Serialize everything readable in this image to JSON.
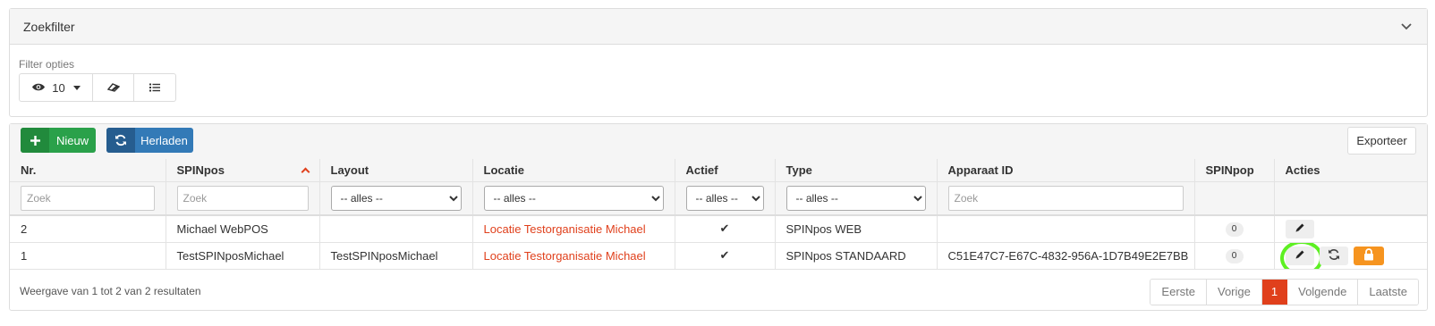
{
  "filter": {
    "title": "Zoekfilter",
    "options_label": "Filter opties",
    "page_size": "10"
  },
  "toolbar": {
    "new_label": "Nieuw",
    "reload_label": "Herladen",
    "export_label": "Exporteer"
  },
  "table": {
    "columns": [
      "Nr.",
      "SPINpos",
      "Layout",
      "Locatie",
      "Actief",
      "Type",
      "Apparaat ID",
      "SPINpop",
      "Acties"
    ],
    "filters": {
      "nr_placeholder": "Zoek",
      "spinpos_placeholder": "Zoek",
      "apparaat_placeholder": "Zoek",
      "all_option": "-- alles --"
    },
    "rows": [
      {
        "nr": "2",
        "spinpos": "Michael WebPOS",
        "layout": "",
        "locatie": "Locatie Testorganisatie Michael",
        "actief": "✔",
        "type": "SPINpos WEB",
        "apparaat_id": "",
        "spinpop": "0"
      },
      {
        "nr": "1",
        "spinpos": "TestSPINposMichael",
        "layout": "TestSPINposMichael",
        "locatie": "Locatie Testorganisatie Michael",
        "actief": "✔",
        "type": "SPINpos STANDAARD",
        "apparaat_id": "C51E47C7-E67C-4832-956A-1D7B49E2E7BB",
        "spinpop": "0"
      }
    ]
  },
  "footer": {
    "summary": "Weergave van 1 tot 2 van 2 resultaten",
    "pager": {
      "first": "Eerste",
      "prev": "Vorige",
      "current": "1",
      "next": "Volgende",
      "last": "Laatste"
    }
  },
  "colors": {
    "accent": "#e0401c",
    "success": "#2aa14a",
    "primary": "#337ab7",
    "warning": "#f6941f",
    "highlight": "#5df022"
  },
  "icons": [
    "chevron-down-icon",
    "eye-icon",
    "caret-down-icon",
    "eraser-icon",
    "list-icon",
    "plus-icon",
    "refresh-icon",
    "sort-up-icon",
    "pencil-icon",
    "sync-icon",
    "lock-icon"
  ]
}
